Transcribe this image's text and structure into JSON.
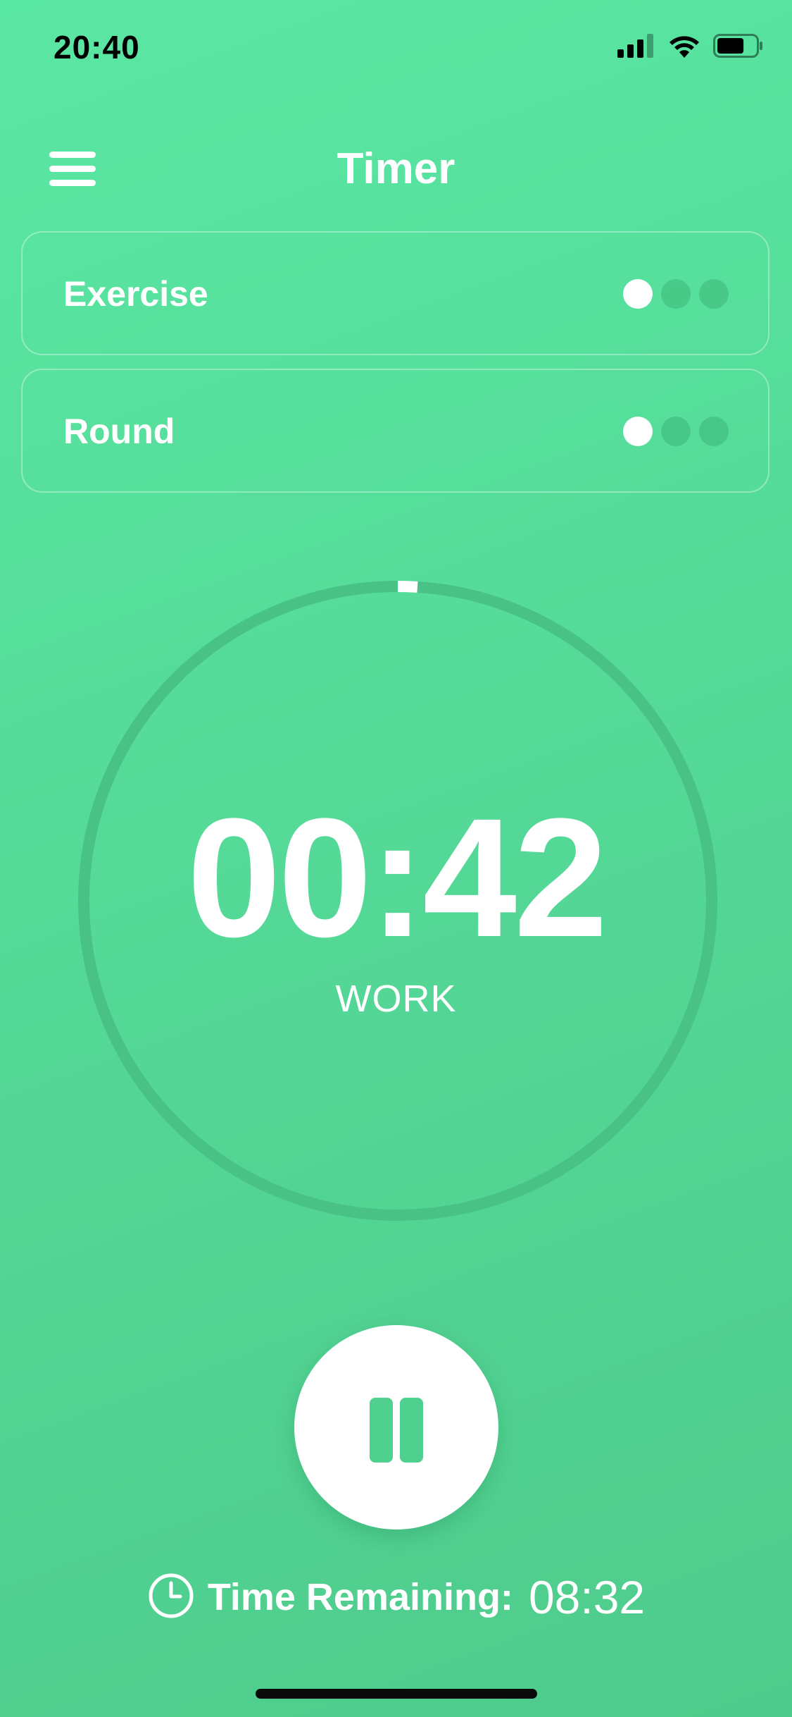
{
  "status_bar": {
    "time": "20:40",
    "icons": [
      "signal-icon",
      "wifi-icon",
      "battery-icon"
    ],
    "battery_level": 0.7
  },
  "header": {
    "title": "Timer",
    "menu_icon": "hamburger-menu-icon"
  },
  "progress": {
    "exercise": {
      "label": "Exercise",
      "total": 3,
      "current": 1
    },
    "round": {
      "label": "Round",
      "total": 3,
      "current": 1
    }
  },
  "timer": {
    "value": "00:42",
    "phase": "WORK",
    "ring_progress": 0.01
  },
  "controls": {
    "pause_icon": "pause-icon"
  },
  "remaining": {
    "icon": "clock-icon",
    "label": "Time Remaining:",
    "value": "08:32"
  },
  "colors": {
    "background_top": "#5ae7a3",
    "background_bottom": "#4ecb8c",
    "accent": "#4fd08f",
    "ring_track": "#48c286",
    "foreground": "#ffffff"
  }
}
